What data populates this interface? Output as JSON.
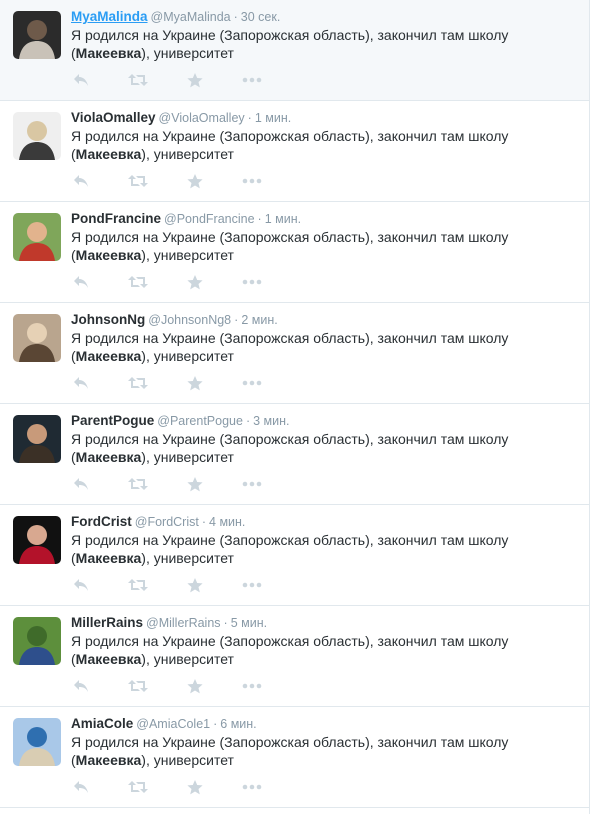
{
  "tweets": [
    {
      "name": "MyaMalinda",
      "handle": "@MyaMalinda",
      "sep": "·",
      "time": "30 сек.",
      "text_before": "Я родился на Украине (Запорожская область), закончил там школу (",
      "text_bold": "Макеевка",
      "text_after": "), университет",
      "avatar_colors": [
        "#2b2b2b",
        "#6e5a4a",
        "#c9c2b8"
      ]
    },
    {
      "name": "ViolaOmalley",
      "handle": "@ViolaOmalley",
      "sep": "·",
      "time": "1 мин.",
      "text_before": "Я родился на Украине (Запорожская область), закончил там школу (",
      "text_bold": "Макеевка",
      "text_after": "), университет",
      "avatar_colors": [
        "#efefef",
        "#d9c7a3",
        "#3a3a3a"
      ]
    },
    {
      "name": "PondFrancine",
      "handle": "@PondFrancine",
      "sep": "·",
      "time": "1 мин.",
      "text_before": "Я родился на Украине (Запорожская область), закончил там школу (",
      "text_bold": "Макеевка",
      "text_after": "), университет",
      "avatar_colors": [
        "#7fa65a",
        "#e2b38d",
        "#c0392b"
      ]
    },
    {
      "name": "JohnsonNg",
      "handle": "@JohnsonNg8",
      "sep": "·",
      "time": "2 мин.",
      "text_before": "Я родился на Украине (Запорожская область), закончил там школу (",
      "text_bold": "Макеевка",
      "text_after": "), университет",
      "avatar_colors": [
        "#b9a58e",
        "#e6d1b5",
        "#5a4634"
      ]
    },
    {
      "name": "ParentPogue",
      "handle": "@ParentPogue",
      "sep": "·",
      "time": "3 мин.",
      "text_before": "Я родился на Украине (Запорожская область), закончил там школу (",
      "text_bold": "Макеевка",
      "text_after": "), университет",
      "avatar_colors": [
        "#1f2a33",
        "#c89a7a",
        "#3b3026"
      ]
    },
    {
      "name": "FordCrist",
      "handle": "@FordCrist",
      "sep": "·",
      "time": "4 мин.",
      "text_before": "Я родился на Украине (Запорожская область), закончил там школу (",
      "text_bold": "Макеевка",
      "text_after": "), университет",
      "avatar_colors": [
        "#111111",
        "#d8a890",
        "#b3122a"
      ]
    },
    {
      "name": "MillerRains",
      "handle": "@MillerRains",
      "sep": "·",
      "time": "5 мин.",
      "text_before": "Я родился на Украине (Запорожская область), закончил там школу (",
      "text_bold": "Макеевка",
      "text_after": "), университет",
      "avatar_colors": [
        "#5d8f3c",
        "#3f6b2a",
        "#2e4f8c"
      ]
    },
    {
      "name": "AmiaCole",
      "handle": "@AmiaCole1",
      "sep": "·",
      "time": "6 мин.",
      "text_before": "Я родился на Украине (Запорожская область), закончил там школу (",
      "text_bold": "Макеевка",
      "text_after": "), университет",
      "avatar_colors": [
        "#a9c8e8",
        "#2f6fb0",
        "#d9cdb3"
      ]
    }
  ],
  "icons": {
    "reply": "reply-icon",
    "retweet": "retweet-icon",
    "favorite": "star-icon",
    "more": "more-dots-icon"
  },
  "colors": {
    "icon": "#ccd6dd",
    "link": "#2a9df4",
    "muted": "#8899a6",
    "border": "#e1e8ed",
    "highlight_bg": "#f5f8fa"
  }
}
